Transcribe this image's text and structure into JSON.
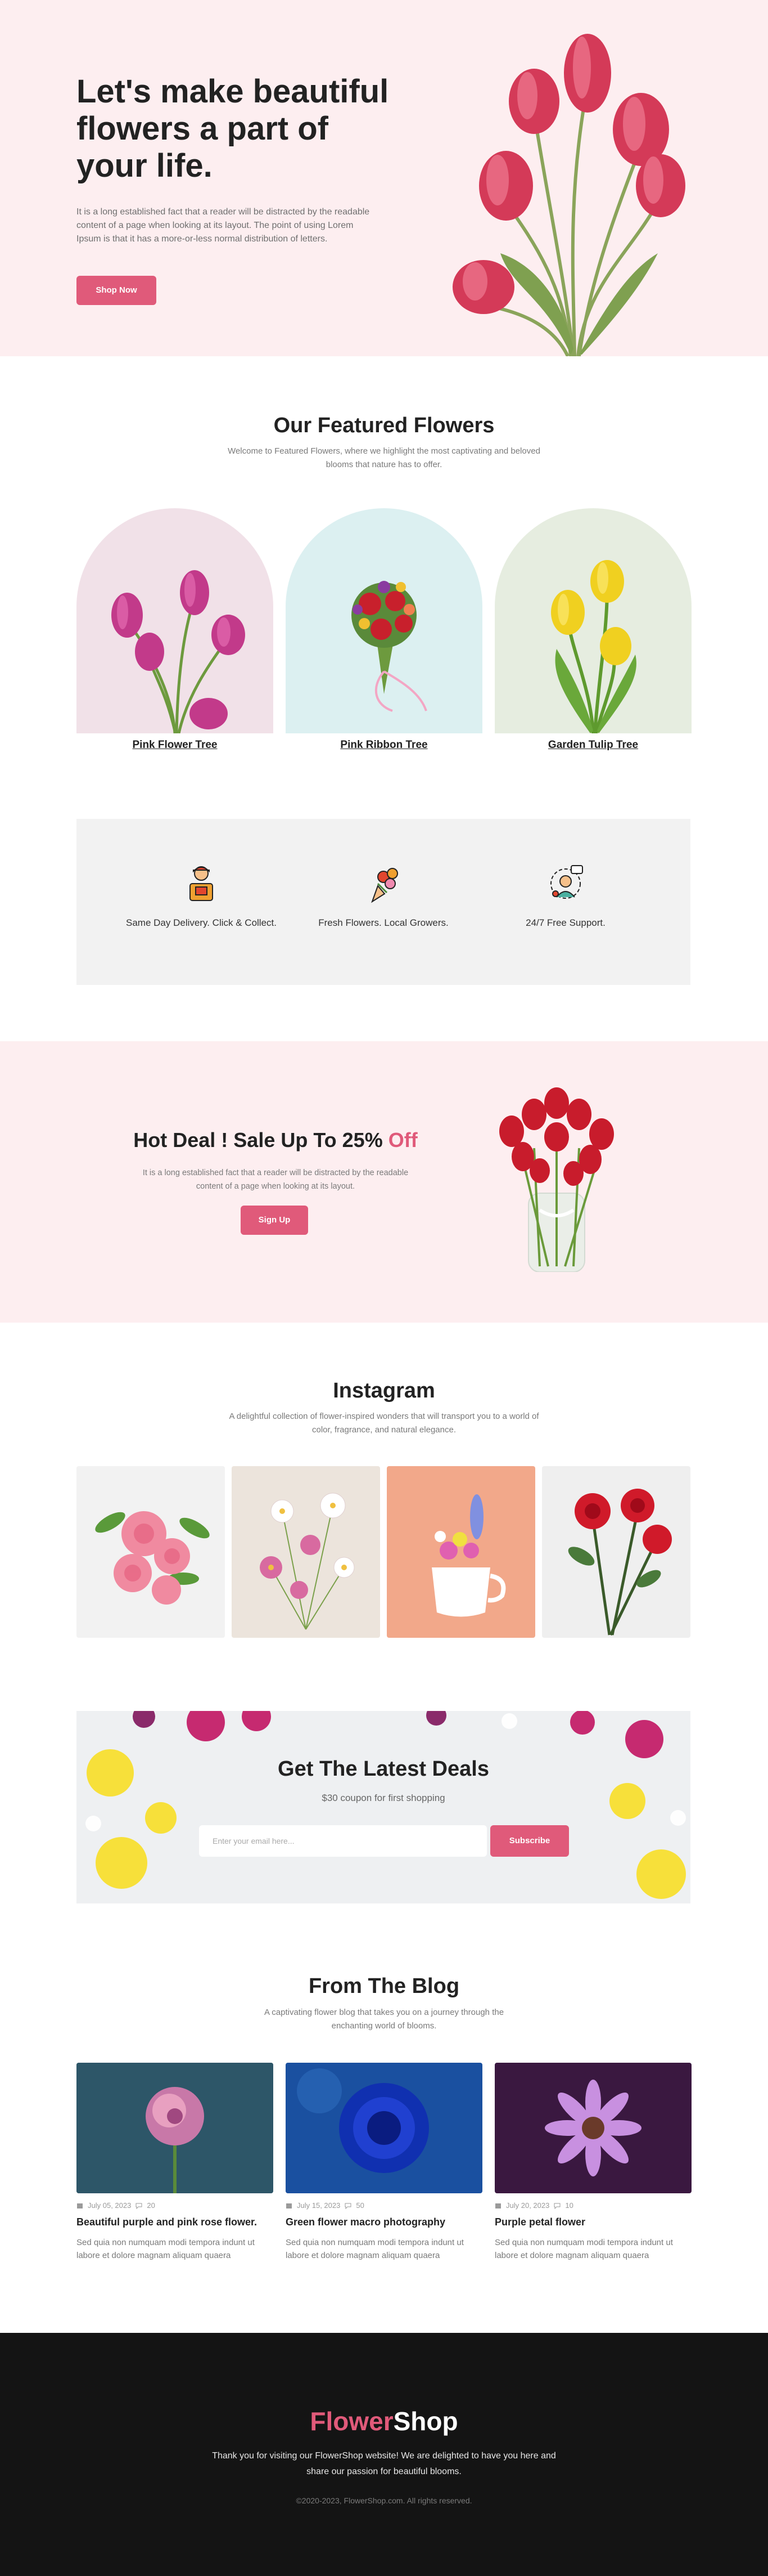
{
  "hero": {
    "title": "Let's make beautiful flowers a part of your life.",
    "text": "It is a long established fact that a reader will be distracted by the readable content of a page when looking at its layout. The point of using Lorem Ipsum is that it has a more-or-less normal distribution of letters.",
    "button": "Shop Now"
  },
  "featured": {
    "title": "Our Featured Flowers",
    "subtitle": "Welcome to Featured Flowers, where we highlight the most captivating and beloved blooms that nature has to offer.",
    "items": [
      {
        "label": "Pink Flower Tree",
        "bg": "#f1e1e8"
      },
      {
        "label": "Pink Ribbon Tree",
        "bg": "#dcf0f1"
      },
      {
        "label": "Garden Tulip Tree",
        "bg": "#e6ede0"
      }
    ]
  },
  "features": [
    {
      "label": "Same Day Delivery. Click & Collect.",
      "icon": "delivery-person-icon"
    },
    {
      "label": "Fresh Flowers. Local Growers.",
      "icon": "bouquet-icon"
    },
    {
      "label": "24/7 Free Support.",
      "icon": "support-agent-icon"
    }
  ],
  "deal": {
    "title": "Hot Deal ! Sale Up To 25% ",
    "title_accent": "Off",
    "text": "It is a long established fact that a reader will be distracted by the readable content of a page when looking at its layout.",
    "button": "Sign Up"
  },
  "instagram": {
    "title": "Instagram",
    "subtitle": "A delightful collection of flower-inspired wonders that will transport you to a world of color, fragrance, and natural elegance."
  },
  "newsletter": {
    "title": "Get The Latest Deals",
    "subtitle": "$30 coupon for first shopping",
    "placeholder": "Enter your email here...",
    "button": "Subscribe"
  },
  "blog": {
    "title": "From The Blog",
    "subtitle": "A captivating flower blog that takes you on a journey through the enchanting world of blooms.",
    "posts": [
      {
        "date": "July 05, 2023",
        "comments": "20",
        "title": "Beautiful purple and pink rose flower.",
        "text": "Sed quia non numquam modi tempora indunt ut labore et dolore magnam aliquam quaera"
      },
      {
        "date": "July 15, 2023",
        "comments": "50",
        "title": "Green flower macro photography",
        "text": "Sed quia non numquam modi tempora indunt ut labore et dolore magnam aliquam quaera"
      },
      {
        "date": "July 20, 2023",
        "comments": "10",
        "title": "Purple petal flower",
        "text": "Sed quia non numquam modi tempora indunt ut labore et dolore magnam aliquam quaera"
      }
    ]
  },
  "footer": {
    "logo_a": "Flower",
    "logo_b": "Shop",
    "thanks": "Thank you for visiting our FlowerShop website! We are delighted to have you here and share our passion for beautiful blooms.",
    "copyright": "©2020-2023, FlowerShop.com. All rights reserved."
  },
  "colors": {
    "accent": "#e05a7a",
    "hero_bg": "#fdeef0",
    "footer_bg": "#141414"
  }
}
